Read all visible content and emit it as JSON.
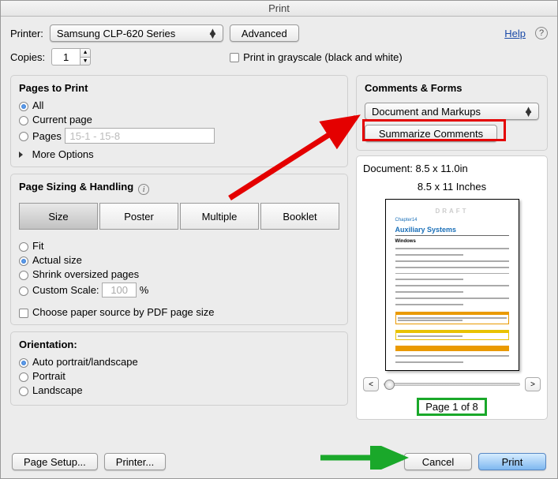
{
  "title": "Print",
  "header": {
    "printer_label": "Printer:",
    "printer_value": "Samsung CLP-620 Series",
    "advanced": "Advanced",
    "copies_label": "Copies:",
    "copies_value": "1",
    "grayscale": "Print in grayscale (black and white)",
    "help": "Help"
  },
  "pages": {
    "heading": "Pages to Print",
    "all": "All",
    "current": "Current page",
    "pages": "Pages",
    "pages_placeholder": "15-1 - 15-8",
    "more": "More Options"
  },
  "sizing": {
    "heading": "Page Sizing & Handling",
    "size": "Size",
    "poster": "Poster",
    "multiple": "Multiple",
    "booklet": "Booklet",
    "fit": "Fit",
    "actual": "Actual size",
    "shrink": "Shrink oversized pages",
    "custom": "Custom Scale:",
    "scale_value": "100",
    "percent": "%",
    "paper_source": "Choose paper source by PDF page size"
  },
  "orient": {
    "heading": "Orientation:",
    "auto": "Auto portrait/landscape",
    "portrait": "Portrait",
    "landscape": "Landscape"
  },
  "comments": {
    "heading": "Comments & Forms",
    "value": "Document and Markups",
    "summarize": "Summarize Comments"
  },
  "preview": {
    "doc": "Document: 8.5 x 11.0in",
    "dims": "8.5 x 11 Inches",
    "page_ind": "Page 1 of 8",
    "draft": "DRAFT",
    "chapter": "Chapter14",
    "title": "Auxiliary Systems",
    "subhead": "Windows"
  },
  "footer": {
    "page_setup": "Page Setup...",
    "printer": "Printer...",
    "cancel": "Cancel",
    "print": "Print"
  }
}
